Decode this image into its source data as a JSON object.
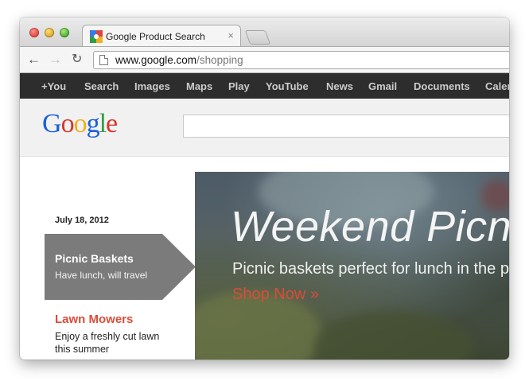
{
  "browser": {
    "tab_title": "Google Product Search",
    "tab_close": "×",
    "url_host": "www.google.com",
    "url_path": "/shopping",
    "nav": {
      "back": "←",
      "forward": "→",
      "reload": "↻"
    }
  },
  "gbar": {
    "items": [
      "+You",
      "Search",
      "Images",
      "Maps",
      "Play",
      "YouTube",
      "News",
      "Gmail",
      "Documents",
      "Calendar"
    ]
  },
  "header": {
    "logo_letters": [
      "G",
      "o",
      "o",
      "g",
      "l",
      "e"
    ],
    "logo_colors": [
      "#1a5fd9",
      "#d6362b",
      "#f2b01e",
      "#1a5fd9",
      "#2f9e43",
      "#d6362b"
    ],
    "search_value": ""
  },
  "sidebar": {
    "date": "July 18, 2012",
    "promos": [
      {
        "title": "Picnic Baskets",
        "subtitle": "Have lunch, will travel"
      },
      {
        "title": "Lawn Mowers",
        "subtitle": "Enjoy a freshly cut lawn this summer"
      }
    ]
  },
  "hero": {
    "title": "Weekend Picnic",
    "subtitle": "Picnic baskets perfect for lunch in the park",
    "cta": "Shop Now »",
    "cta_color": "#dd4b39"
  }
}
